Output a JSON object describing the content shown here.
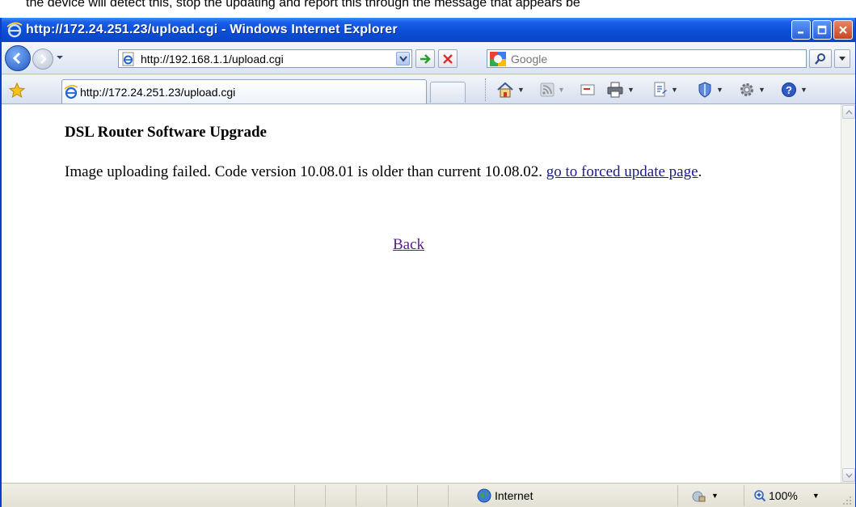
{
  "caption_text": "the device will detect this, stop the updating and report this through the message that appears be",
  "window": {
    "title": "http://172.24.251.23/upload.cgi - Windows Internet Explorer"
  },
  "address": {
    "url": "http://192.168.1.1/upload.cgi"
  },
  "search": {
    "placeholder": "Google"
  },
  "tabs": [
    {
      "label": "http://172.24.251.23/upload.cgi"
    }
  ],
  "page": {
    "heading": "DSL Router Software Upgrade",
    "message": "Image uploading failed. Code version 10.08.01 is older than current 10.08.02.",
    "forced_link": "go to forced update page",
    "period": ".",
    "back_link": "Back"
  },
  "status": {
    "zone": "Internet",
    "zoom": "100%"
  },
  "colors": {
    "titlebar": "#0b4fd8",
    "link": "#1a1a8c",
    "visited_link": "#551a8b"
  }
}
